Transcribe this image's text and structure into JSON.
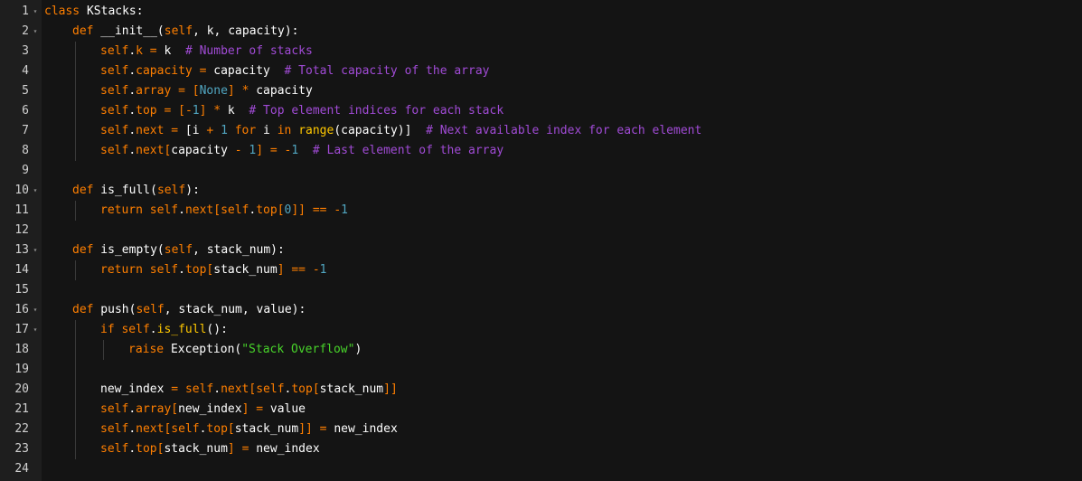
{
  "editor": {
    "language": "python",
    "colors": {
      "background": "#141414",
      "gutter_background": "#1e1e1e",
      "line_number": "#d0d0d0",
      "keyword": "#ff7f00",
      "comment": "#a14bd6",
      "string": "#48d42a",
      "builtin": "#ffc800",
      "number": "#51a6c1",
      "plain": "#ffffff"
    },
    "lines": [
      {
        "num": "1",
        "fold": true,
        "indent": 0,
        "tokens": [
          [
            "kw",
            "class"
          ],
          [
            "pl",
            " KStacks:"
          ]
        ]
      },
      {
        "num": "2",
        "fold": true,
        "indent": 1,
        "tokens": [
          [
            "kw",
            "def"
          ],
          [
            "pl",
            " __init__("
          ],
          [
            "sf",
            "self"
          ],
          [
            "pl",
            ", k, capacity):"
          ]
        ]
      },
      {
        "num": "3",
        "fold": false,
        "indent": 2,
        "tokens": [
          [
            "sf",
            "self"
          ],
          [
            "pl",
            "."
          ],
          [
            "sf",
            "k"
          ],
          [
            "pl",
            " "
          ],
          [
            "op",
            "="
          ],
          [
            "pl",
            " k  "
          ],
          [
            "cm",
            "# Number of stacks"
          ]
        ]
      },
      {
        "num": "4",
        "fold": false,
        "indent": 2,
        "tokens": [
          [
            "sf",
            "self"
          ],
          [
            "pl",
            "."
          ],
          [
            "sf",
            "capacity"
          ],
          [
            "pl",
            " "
          ],
          [
            "op",
            "="
          ],
          [
            "pl",
            " capacity  "
          ],
          [
            "cm",
            "# Total capacity of the array"
          ]
        ]
      },
      {
        "num": "5",
        "fold": false,
        "indent": 2,
        "tokens": [
          [
            "sf",
            "self"
          ],
          [
            "pl",
            "."
          ],
          [
            "sf",
            "array"
          ],
          [
            "pl",
            " "
          ],
          [
            "op",
            "="
          ],
          [
            "pl",
            " "
          ],
          [
            "op",
            "["
          ],
          [
            "nm",
            "None"
          ],
          [
            "op",
            "]"
          ],
          [
            "pl",
            " "
          ],
          [
            "op",
            "*"
          ],
          [
            "pl",
            " capacity"
          ]
        ]
      },
      {
        "num": "6",
        "fold": false,
        "indent": 2,
        "tokens": [
          [
            "sf",
            "self"
          ],
          [
            "pl",
            "."
          ],
          [
            "sf",
            "top"
          ],
          [
            "pl",
            " "
          ],
          [
            "op",
            "="
          ],
          [
            "pl",
            " "
          ],
          [
            "op",
            "["
          ],
          [
            "op",
            "-"
          ],
          [
            "nm",
            "1"
          ],
          [
            "op",
            "]"
          ],
          [
            "pl",
            " "
          ],
          [
            "op",
            "*"
          ],
          [
            "pl",
            " k  "
          ],
          [
            "cm",
            "# Top element indices for each stack"
          ]
        ]
      },
      {
        "num": "7",
        "fold": false,
        "indent": 2,
        "tokens": [
          [
            "sf",
            "self"
          ],
          [
            "pl",
            "."
          ],
          [
            "sf",
            "next"
          ],
          [
            "pl",
            " "
          ],
          [
            "op",
            "="
          ],
          [
            "pl",
            " [i "
          ],
          [
            "op",
            "+"
          ],
          [
            "pl",
            " "
          ],
          [
            "nm",
            "1"
          ],
          [
            "pl",
            " "
          ],
          [
            "kw",
            "for"
          ],
          [
            "pl",
            " i "
          ],
          [
            "kw",
            "in"
          ],
          [
            "pl",
            " "
          ],
          [
            "bi",
            "range"
          ],
          [
            "pl",
            "(capacity)]  "
          ],
          [
            "cm",
            "# Next available index for each element"
          ]
        ]
      },
      {
        "num": "8",
        "fold": false,
        "indent": 2,
        "tokens": [
          [
            "sf",
            "self"
          ],
          [
            "pl",
            "."
          ],
          [
            "sf",
            "next"
          ],
          [
            "op",
            "["
          ],
          [
            "pl",
            "capacity "
          ],
          [
            "op",
            "-"
          ],
          [
            "pl",
            " "
          ],
          [
            "nm",
            "1"
          ],
          [
            "op",
            "]"
          ],
          [
            "pl",
            " "
          ],
          [
            "op",
            "="
          ],
          [
            "pl",
            " "
          ],
          [
            "op",
            "-"
          ],
          [
            "nm",
            "1"
          ],
          [
            "pl",
            "  "
          ],
          [
            "cm",
            "# Last element of the array"
          ]
        ]
      },
      {
        "num": "9",
        "fold": false,
        "indent": 0,
        "tokens": []
      },
      {
        "num": "10",
        "fold": true,
        "indent": 1,
        "tokens": [
          [
            "kw",
            "def"
          ],
          [
            "pl",
            " is_full("
          ],
          [
            "sf",
            "self"
          ],
          [
            "pl",
            "):"
          ]
        ]
      },
      {
        "num": "11",
        "fold": false,
        "indent": 2,
        "tokens": [
          [
            "kw",
            "return"
          ],
          [
            "pl",
            " "
          ],
          [
            "sf",
            "self"
          ],
          [
            "pl",
            "."
          ],
          [
            "sf",
            "next"
          ],
          [
            "op",
            "["
          ],
          [
            "sf",
            "self"
          ],
          [
            "pl",
            "."
          ],
          [
            "sf",
            "top"
          ],
          [
            "op",
            "["
          ],
          [
            "nm",
            "0"
          ],
          [
            "op",
            "]]"
          ],
          [
            "pl",
            " "
          ],
          [
            "op",
            "=="
          ],
          [
            "pl",
            " "
          ],
          [
            "op",
            "-"
          ],
          [
            "nm",
            "1"
          ]
        ]
      },
      {
        "num": "12",
        "fold": false,
        "indent": 0,
        "tokens": []
      },
      {
        "num": "13",
        "fold": true,
        "indent": 1,
        "tokens": [
          [
            "kw",
            "def"
          ],
          [
            "pl",
            " is_empty("
          ],
          [
            "sf",
            "self"
          ],
          [
            "pl",
            ", stack_num):"
          ]
        ]
      },
      {
        "num": "14",
        "fold": false,
        "indent": 2,
        "tokens": [
          [
            "kw",
            "return"
          ],
          [
            "pl",
            " "
          ],
          [
            "sf",
            "self"
          ],
          [
            "pl",
            "."
          ],
          [
            "sf",
            "top"
          ],
          [
            "op",
            "["
          ],
          [
            "pl",
            "stack_num"
          ],
          [
            "op",
            "]"
          ],
          [
            "pl",
            " "
          ],
          [
            "op",
            "=="
          ],
          [
            "pl",
            " "
          ],
          [
            "op",
            "-"
          ],
          [
            "nm",
            "1"
          ]
        ]
      },
      {
        "num": "15",
        "fold": false,
        "indent": 0,
        "tokens": []
      },
      {
        "num": "16",
        "fold": true,
        "indent": 1,
        "tokens": [
          [
            "kw",
            "def"
          ],
          [
            "pl",
            " push("
          ],
          [
            "sf",
            "self"
          ],
          [
            "pl",
            ", stack_num, value):"
          ]
        ]
      },
      {
        "num": "17",
        "fold": true,
        "indent": 2,
        "tokens": [
          [
            "kw",
            "if"
          ],
          [
            "pl",
            " "
          ],
          [
            "sf",
            "self"
          ],
          [
            "pl",
            "."
          ],
          [
            "bi",
            "is_full"
          ],
          [
            "pl",
            "():"
          ]
        ]
      },
      {
        "num": "18",
        "fold": false,
        "indent": 3,
        "tokens": [
          [
            "kw",
            "raise"
          ],
          [
            "pl",
            " Exception("
          ],
          [
            "st",
            "\"Stack Overflow\""
          ],
          [
            "pl",
            ")"
          ]
        ]
      },
      {
        "num": "19",
        "fold": false,
        "indent": 0,
        "tokens": []
      },
      {
        "num": "20",
        "fold": false,
        "indent": 2,
        "tokens": [
          [
            "pl",
            "new_index "
          ],
          [
            "op",
            "="
          ],
          [
            "pl",
            " "
          ],
          [
            "sf",
            "self"
          ],
          [
            "pl",
            "."
          ],
          [
            "sf",
            "next"
          ],
          [
            "op",
            "["
          ],
          [
            "sf",
            "self"
          ],
          [
            "pl",
            "."
          ],
          [
            "sf",
            "top"
          ],
          [
            "op",
            "["
          ],
          [
            "pl",
            "stack_num"
          ],
          [
            "op",
            "]]"
          ]
        ]
      },
      {
        "num": "21",
        "fold": false,
        "indent": 2,
        "tokens": [
          [
            "sf",
            "self"
          ],
          [
            "pl",
            "."
          ],
          [
            "sf",
            "array"
          ],
          [
            "op",
            "["
          ],
          [
            "pl",
            "new_index"
          ],
          [
            "op",
            "]"
          ],
          [
            "pl",
            " "
          ],
          [
            "op",
            "="
          ],
          [
            "pl",
            " value"
          ]
        ]
      },
      {
        "num": "22",
        "fold": false,
        "indent": 2,
        "tokens": [
          [
            "sf",
            "self"
          ],
          [
            "pl",
            "."
          ],
          [
            "sf",
            "next"
          ],
          [
            "op",
            "["
          ],
          [
            "sf",
            "self"
          ],
          [
            "pl",
            "."
          ],
          [
            "sf",
            "top"
          ],
          [
            "op",
            "["
          ],
          [
            "pl",
            "stack_num"
          ],
          [
            "op",
            "]]"
          ],
          [
            "pl",
            " "
          ],
          [
            "op",
            "="
          ],
          [
            "pl",
            " new_index"
          ]
        ]
      },
      {
        "num": "23",
        "fold": false,
        "indent": 2,
        "tokens": [
          [
            "sf",
            "self"
          ],
          [
            "pl",
            "."
          ],
          [
            "sf",
            "top"
          ],
          [
            "op",
            "["
          ],
          [
            "pl",
            "stack_num"
          ],
          [
            "op",
            "]"
          ],
          [
            "pl",
            " "
          ],
          [
            "op",
            "="
          ],
          [
            "pl",
            " new_index"
          ]
        ]
      },
      {
        "num": "24",
        "fold": false,
        "indent": 0,
        "tokens": []
      }
    ]
  }
}
